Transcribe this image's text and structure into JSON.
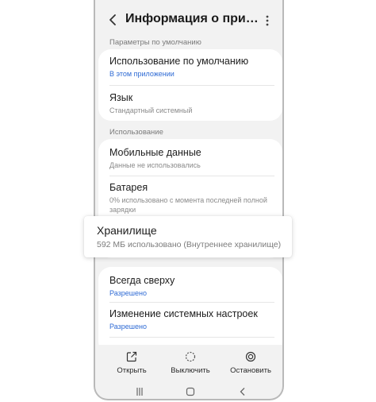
{
  "header": {
    "title": "Информация о приложении",
    "back_icon": "chevron-left-icon",
    "more_icon": "more-vertical-icon"
  },
  "sections": {
    "defaults_label": "Параметры по умолчанию",
    "usage_label": "Использование"
  },
  "defaults": {
    "default_use": {
      "title": "Использование по умолчанию",
      "subtitle": "В этом приложении"
    },
    "language": {
      "title": "Язык",
      "subtitle": "Стандартный системный"
    }
  },
  "usage": {
    "mobile_data": {
      "title": "Мобильные данные",
      "subtitle": "Данные не использовались"
    },
    "battery": {
      "title": "Батарея",
      "subtitle": "0% использовано с момента последней полной зарядки"
    },
    "storage": {
      "title": "Хранилище",
      "subtitle": "592 МБ использовано (Внутреннее хранилище)"
    }
  },
  "advanced": {
    "always_on_top": {
      "title": "Всегда сверху",
      "subtitle": "Разрешено"
    },
    "modify_system_settings": {
      "title": "Изменение системных настроек",
      "subtitle": "Разрешено"
    }
  },
  "bottom_actions": [
    {
      "label": "Открыть",
      "icon": "open-external-icon"
    },
    {
      "label": "Выключить",
      "icon": "disable-dashed-circle-icon"
    },
    {
      "label": "Остановить",
      "icon": "stop-circle-icon"
    }
  ],
  "colors": {
    "accent_blue": "#2f6bd4",
    "background": "#f2f2f2",
    "card": "#ffffff"
  }
}
